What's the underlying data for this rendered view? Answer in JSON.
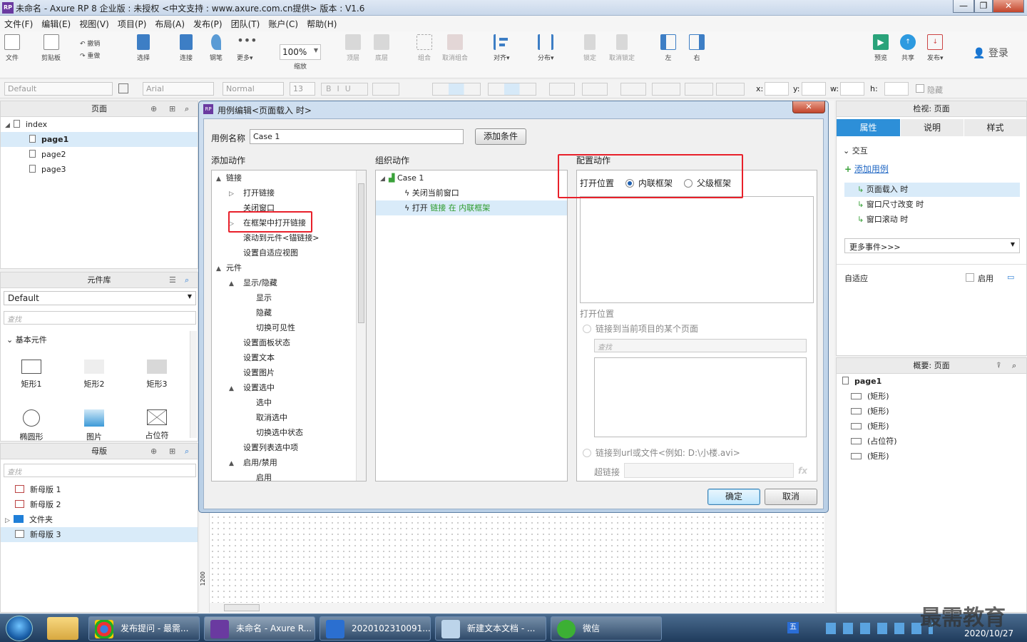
{
  "window": {
    "title": "未命名 - Axure RP 8 企业版 : 未授权     <中文支持 : www.axure.com.cn提供> 版本 : V1.6",
    "app_icon": "RP",
    "buttons": [
      "—",
      "❐",
      "✕"
    ]
  },
  "menu": [
    "文件(F)",
    "编辑(E)",
    "视图(V)",
    "项目(P)",
    "布局(A)",
    "发布(P)",
    "团队(T)",
    "账户(C)",
    "帮助(H)"
  ],
  "toolbar": {
    "file": "文件",
    "clipboard": "剪贴板",
    "undo": "撤销",
    "redo": "重做",
    "select": "选择",
    "connect": "连接",
    "pen": "钢笔",
    "more": "更多▾",
    "zoom_value": "100%",
    "zoom_label": "缩放",
    "top": "顶层",
    "bottom": "底层",
    "group": "组合",
    "ungroup": "取消组合",
    "align": "对齐▾",
    "distribute": "分布▾",
    "lock": "锁定",
    "unlock": "取消锁定",
    "left": "左",
    "right": "右",
    "preview": "预览",
    "share": "共享",
    "publish": "发布▾",
    "login": "登录"
  },
  "format_bar": {
    "style": "Default",
    "font": "Arial",
    "weight": "Normal",
    "size": "13",
    "x_label": "x:",
    "y_label": "y:",
    "w_label": "w:",
    "h_label": "h:",
    "hide_label": "隐藏"
  },
  "pages_panel": {
    "title": "页面",
    "root": "index",
    "pages": [
      "page1",
      "page2",
      "page3"
    ]
  },
  "library_panel": {
    "title": "元件库",
    "library": "Default",
    "search_placeholder": "查找",
    "group": "基本元件",
    "widgets": [
      "矩形1",
      "矩形2",
      "矩形3",
      "椭圆形",
      "图片",
      "占位符"
    ]
  },
  "masters_panel": {
    "title": "母版",
    "search_placeholder": "查找",
    "items": [
      "新母版 1",
      "新母版 2",
      "文件夹",
      "新母版 3"
    ]
  },
  "inspector": {
    "title": "检视: 页面",
    "tabs": [
      "属性",
      "说明",
      "样式"
    ],
    "section": "交互",
    "add_case": "添加用例",
    "events": [
      "页面载入 时",
      "窗口尺寸改变 时",
      "窗口滚动 时"
    ],
    "more_events": "更多事件>>>",
    "adaptive": "自适应",
    "enable": "启用"
  },
  "outline": {
    "title": "概要: 页面",
    "page": "page1",
    "items": [
      "(矩形)",
      "(矩形)",
      "(矩形)",
      "(占位符)",
      "(矩形)"
    ]
  },
  "dialog": {
    "title": "用例编辑<页面载入 时>",
    "case_name_label": "用例名称",
    "case_name_value": "Case 1",
    "add_condition": "添加条件",
    "add_action_header": "添加动作",
    "organize_header": "组织动作",
    "config_header": "配置动作",
    "actions": [
      {
        "label": "链接",
        "level": 0,
        "expand": "▲"
      },
      {
        "label": "打开链接",
        "level": 1,
        "expand": "▷"
      },
      {
        "label": "关闭窗口",
        "level": 1,
        "expand": ""
      },
      {
        "label": "在框架中打开链接",
        "level": 1,
        "expand": "▷"
      },
      {
        "label": "滚动到元件<锚链接>",
        "level": 1,
        "expand": ""
      },
      {
        "label": "设置自适应视图",
        "level": 1,
        "expand": ""
      },
      {
        "label": "元件",
        "level": 0,
        "expand": "▲"
      },
      {
        "label": "显示/隐藏",
        "level": 1,
        "expand": "▲"
      },
      {
        "label": "显示",
        "level": 2,
        "expand": ""
      },
      {
        "label": "隐藏",
        "level": 2,
        "expand": ""
      },
      {
        "label": "切换可见性",
        "level": 2,
        "expand": ""
      },
      {
        "label": "设置面板状态",
        "level": 1,
        "expand": ""
      },
      {
        "label": "设置文本",
        "level": 1,
        "expand": ""
      },
      {
        "label": "设置图片",
        "level": 1,
        "expand": ""
      },
      {
        "label": "设置选中",
        "level": 1,
        "expand": "▲"
      },
      {
        "label": "选中",
        "level": 2,
        "expand": ""
      },
      {
        "label": "取消选中",
        "level": 2,
        "expand": ""
      },
      {
        "label": "切换选中状态",
        "level": 2,
        "expand": ""
      },
      {
        "label": "设置列表选中项",
        "level": 1,
        "expand": ""
      },
      {
        "label": "启用/禁用",
        "level": 1,
        "expand": "▲"
      },
      {
        "label": "启用",
        "level": 2,
        "expand": ""
      }
    ],
    "organize": {
      "case": "Case 1",
      "item1": "关闭当前窗口",
      "item2_prefix": "打开",
      "item2_link": "链接 在 内联框架"
    },
    "config": {
      "open_in_label": "打开位置",
      "option_inline": "内联框架",
      "option_parent": "父级框架",
      "open_location": "打开位置",
      "link_page": "链接到当前项目的某个页面",
      "search_placeholder": "查找",
      "link_url": "链接到url或文件<例如: D:\\小楼.avi>",
      "hyperlink": "超链接",
      "fx": "fx"
    },
    "ok": "确定",
    "cancel": "取消"
  },
  "canvas": {
    "ruler_label": "1200"
  },
  "taskbar": {
    "tasks": [
      "发布提问 - 最需...",
      "未命名 - Axure R...",
      "2020102310091...",
      "新建文本文档 - ...",
      "微信"
    ],
    "date": "2020/10/27",
    "watermark": "最需教育"
  }
}
